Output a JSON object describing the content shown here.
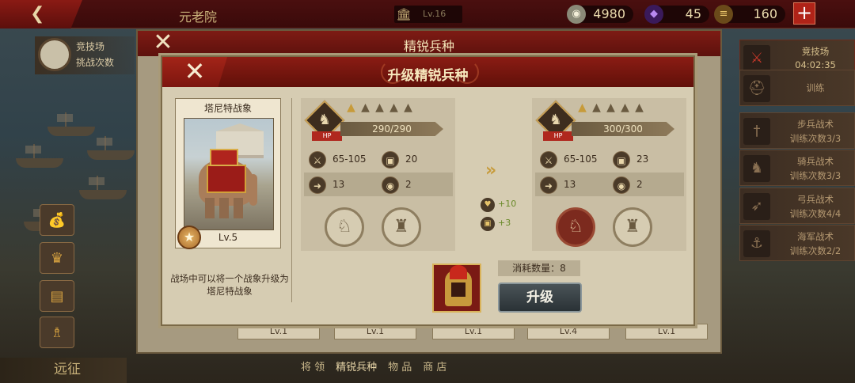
{
  "topbar": {
    "back_icon": "back-arrow-icon",
    "title": "元老院",
    "level_text": "Lv.16",
    "gold": "4980",
    "gems": "45",
    "food": "160",
    "plus_label": "+"
  },
  "left": {
    "arena_line1": "竞技场",
    "arena_line2": "挑战次数",
    "expedition_label": "远征"
  },
  "right": {
    "cards": [
      {
        "line1": "竞技场",
        "line2": "04:02:35",
        "icon": "crossed-swords-icon"
      },
      {
        "line1": "训练",
        "line2": "",
        "icon": "helmet-icon"
      },
      {
        "line1": "步兵战术",
        "line2": "训练次数3/3",
        "icon": "sword-icon"
      },
      {
        "line1": "骑兵战术",
        "line2": "训练次数3/3",
        "icon": "horse-icon"
      },
      {
        "line1": "弓兵战术",
        "line2": "训练次数4/4",
        "icon": "bow-icon"
      },
      {
        "line1": "海军战术",
        "line2": "训练次数2/2",
        "icon": "anchor-icon"
      }
    ]
  },
  "mid_panel": {
    "title": "精锐兵种",
    "close_label": "✕",
    "levels": [
      "Lv.1",
      "Lv.1",
      "Lv.1",
      "Lv.4",
      "Lv.1"
    ],
    "tabs": [
      "将 领",
      "精锐兵种",
      "物 品",
      "商 店"
    ]
  },
  "dialog": {
    "title": "升级精锐兵种",
    "close_label": "✕",
    "unit": {
      "name": "塔尼特战象",
      "level": "Lv.5",
      "description": "战场中可以将一个战象升级为塔尼特战象"
    },
    "current": {
      "hp": "290/290",
      "hp_tag": "HP",
      "stars": 1,
      "attack": "65-105",
      "defense": "20",
      "speed": "13",
      "range": "2"
    },
    "next": {
      "hp": "300/300",
      "hp_tag": "HP",
      "stars": 1,
      "attack": "65-105",
      "defense": "23",
      "speed": "13",
      "range": "2"
    },
    "bonus_hp": "+10",
    "bonus_def": "+3",
    "cost_label": "消耗数量：8",
    "upgrade_label": "升级"
  },
  "colors": {
    "header_red": "#8a1c14",
    "parchment": "#d6ccb2",
    "gold": "#c79b3a",
    "bonus_green": "#6a8a2a"
  }
}
